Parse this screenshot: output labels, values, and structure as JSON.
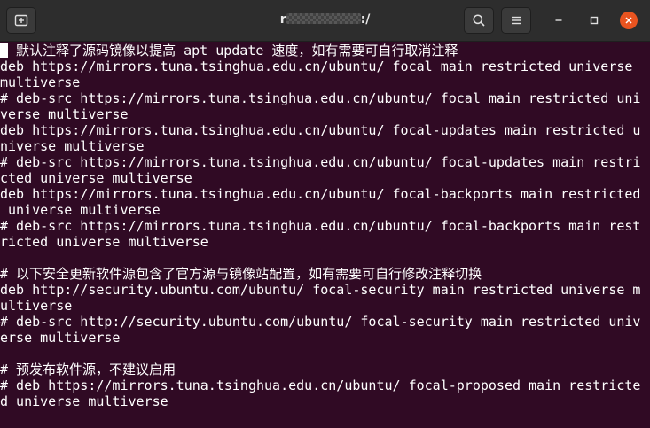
{
  "window": {
    "title_prefix": "r",
    "title_suffix": ":/"
  },
  "terminal": {
    "lines": [
      "# 默认注释了源码镜像以提高 apt update 速度，如有需要可自行取消注释",
      "deb https://mirrors.tuna.tsinghua.edu.cn/ubuntu/ focal main restricted universe",
      "multiverse",
      "# deb-src https://mirrors.tuna.tsinghua.edu.cn/ubuntu/ focal main restricted uni",
      "verse multiverse",
      "deb https://mirrors.tuna.tsinghua.edu.cn/ubuntu/ focal-updates main restricted u",
      "niverse multiverse",
      "# deb-src https://mirrors.tuna.tsinghua.edu.cn/ubuntu/ focal-updates main restri",
      "cted universe multiverse",
      "deb https://mirrors.tuna.tsinghua.edu.cn/ubuntu/ focal-backports main restricted",
      " universe multiverse",
      "# deb-src https://mirrors.tuna.tsinghua.edu.cn/ubuntu/ focal-backports main rest",
      "ricted universe multiverse",
      "",
      "# 以下安全更新软件源包含了官方源与镜像站配置，如有需要可自行修改注释切换",
      "deb http://security.ubuntu.com/ubuntu/ focal-security main restricted universe m",
      "ultiverse",
      "# deb-src http://security.ubuntu.com/ubuntu/ focal-security main restricted univ",
      "erse multiverse",
      "",
      "# 预发布软件源，不建议启用",
      "# deb https://mirrors.tuna.tsinghua.edu.cn/ubuntu/ focal-proposed main restricte",
      "d universe multiverse"
    ]
  }
}
